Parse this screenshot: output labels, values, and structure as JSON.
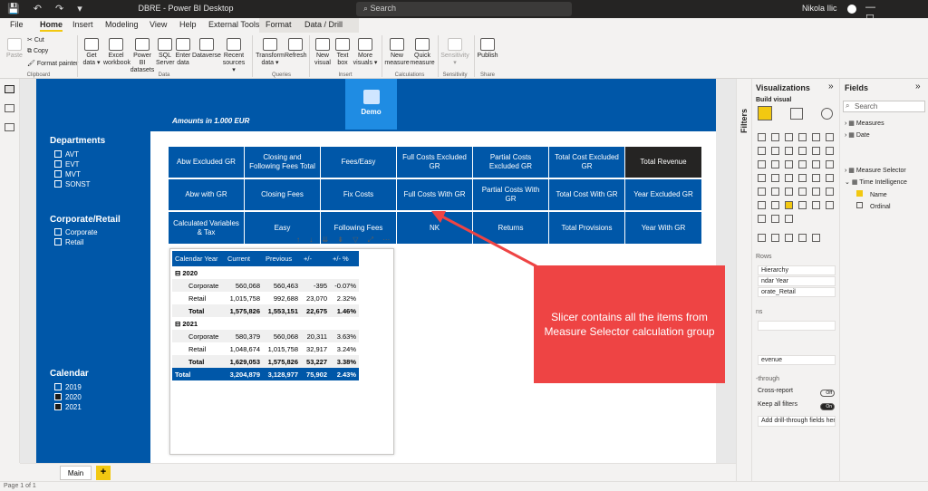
{
  "titlebar": {
    "title": "DBRE - Power BI Desktop",
    "search_placeholder": "Search",
    "user": "Nikola Ilic",
    "icons": "💾 ↶ ↷ ▾",
    "win_buttons": "— ☐ ✕"
  },
  "menu": {
    "items": [
      "File",
      "Home",
      "Insert",
      "Modeling",
      "View",
      "Help",
      "External Tools",
      "Format",
      "Data / Drill"
    ]
  },
  "ribbon": {
    "clipboard": {
      "paste": "Paste",
      "cut": "Cut",
      "copy": "Copy",
      "format_painter": "Format painter",
      "label": "Clipboard"
    },
    "data": {
      "get_data": "Get data ▾",
      "excel": "Excel workbook",
      "powerbi": "Power BI datasets",
      "sql": "SQL Server",
      "enter": "Enter data",
      "dataverse": "Dataverse",
      "recent": "Recent sources ▾",
      "label": "Data"
    },
    "queries": {
      "transform": "Transform data ▾",
      "refresh": "Refresh",
      "label": "Queries"
    },
    "insert": {
      "new_visual": "New visual",
      "text_box": "Text box",
      "more_visuals": "More visuals ▾",
      "label": "Insert"
    },
    "calculations": {
      "new_measure": "New measure",
      "quick_measure": "Quick measure",
      "label": "Calculations"
    },
    "sensitivity": {
      "sensitivity": "Sensitivity ▾",
      "label": "Sensitivity"
    },
    "share": {
      "publish": "Publish",
      "label": "Share"
    }
  },
  "report": {
    "demo_label": "Demo",
    "amounts_label": "Amounts in 1.000 EUR",
    "departments": {
      "title": "Departments",
      "items": [
        "AVT",
        "EVT",
        "MVT",
        "SONST"
      ]
    },
    "corporate_retail": {
      "title": "Corporate/Retail",
      "items": [
        "Corporate",
        "Retail"
      ]
    },
    "calendar": {
      "title": "Calendar",
      "items": [
        "2019",
        "2020",
        "2021"
      ],
      "selected": [
        "2020",
        "2021"
      ]
    },
    "tiles": [
      [
        "Abw Excluded GR",
        "Closing and Following Fees Total",
        "Fees/Easy",
        "Full Costs Excluded GR",
        "Partial Costs Excluded GR",
        "Total Cost Excluded GR",
        "Total Revenue"
      ],
      [
        "Abw with GR",
        "Closing Fees",
        "Fix Costs",
        "Full Costs With GR",
        "Partial Costs With GR",
        "Total Cost With GR",
        "Year Excluded GR"
      ],
      [
        "Calculated Variables & Tax",
        "Easy",
        "Following Fees",
        "NK",
        "Returns",
        "Total Provisions",
        "Year With GR"
      ]
    ],
    "visual_header_icons": "↑ ↓ ⇊ ⇟ ▽ ⤢ ⋯",
    "matrix": {
      "headers": [
        "Calendar Year",
        "Current",
        "Previous",
        "+/-",
        "+/- %"
      ],
      "groups": [
        {
          "year": "2020",
          "rows": [
            [
              "Corporate",
              "560,068",
              "560,463",
              "-395",
              "-0.07%"
            ],
            [
              "Retail",
              "1,015,758",
              "992,688",
              "23,070",
              "2.32%"
            ]
          ],
          "total": [
            "Total",
            "1,575,826",
            "1,553,151",
            "22,675",
            "1.46%"
          ]
        },
        {
          "year": "2021",
          "rows": [
            [
              "Corporate",
              "580,379",
              "560,068",
              "20,311",
              "3.63%"
            ],
            [
              "Retail",
              "1,048,674",
              "1,015,758",
              "32,917",
              "3.24%"
            ]
          ],
          "total": [
            "Total",
            "1,629,053",
            "1,575,826",
            "53,227",
            "3.38%"
          ]
        }
      ],
      "grand_total": [
        "Total",
        "3,204,879",
        "3,128,977",
        "75,902",
        "2.43%"
      ]
    },
    "callout": "Slicer contains all the items from Measure Selector calculation group"
  },
  "pages": {
    "tabs": [
      "Main"
    ],
    "add": "+",
    "status": "Page 1 of 1"
  },
  "filters": {
    "label": "Filters"
  },
  "visualizations": {
    "title": "Visualizations",
    "chevron": "»",
    "build_visual": "Build visual",
    "rows_label": "Rows",
    "rows_items": [
      "Hierarchy",
      "ndar Year",
      "orate_Retail"
    ],
    "columns_label": "ns",
    "values_label": "evenue",
    "drill_label": "-through",
    "cross_report": "Cross-report",
    "cross_report_state": "Off",
    "keep_filters": "Keep all filters",
    "keep_filters_state": "On",
    "add_drill": "Add drill-through fields here"
  },
  "fields": {
    "title": "Fields",
    "chevron": "»",
    "search_placeholder": "Search",
    "items": [
      "Measures",
      "Date",
      "Measure Selector",
      "Time Intelligence",
      "Name",
      "Ordinal"
    ]
  },
  "colors": {
    "brand_blue": "#0057a8",
    "accent_yellow": "#f2c811",
    "callout_red": "#ee4444",
    "dark_tile": "#252423"
  }
}
